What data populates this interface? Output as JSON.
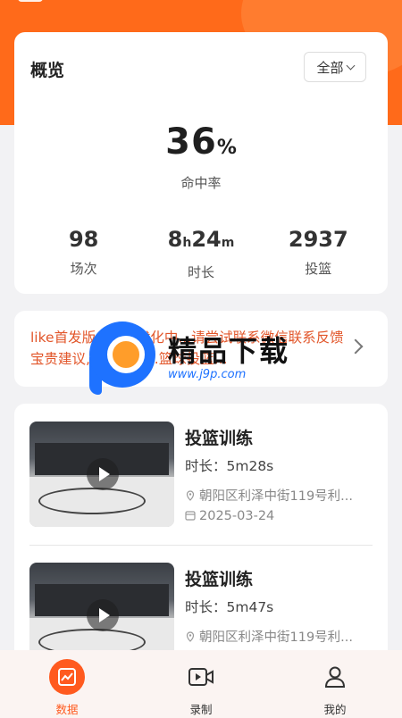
{
  "overview": {
    "title": "概览",
    "filter_label": "全部",
    "hit_rate_value": "36",
    "hit_rate_unit": "%",
    "hit_rate_label": "命中率",
    "stats": [
      {
        "value": "98",
        "label": "场次"
      },
      {
        "value_h": "8",
        "unit_h": "h",
        "value_m": "24",
        "unit_m": "m",
        "label": "时长"
      },
      {
        "value": "2937",
        "label": "投篮"
      }
    ]
  },
  "notice": {
    "text": "like首发版...持续优化中...请尝试联系微信联系反馈宝贵建议,我们打开...篮球投篮..."
  },
  "watermark": {
    "title": "精品下载",
    "url": "www.j9p.com"
  },
  "records": [
    {
      "title": "投篮训练",
      "duration": "时长：5m28s",
      "location": "朝阳区利泽中街119号利...",
      "date": "2025-03-24"
    },
    {
      "title": "投篮训练",
      "duration": "时长：5m47s",
      "location": "朝阳区利泽中街119号利..."
    }
  ],
  "tabbar": {
    "items": [
      {
        "label": "数据",
        "icon": "chart-icon",
        "active": true
      },
      {
        "label": "录制",
        "icon": "video-icon",
        "active": false
      },
      {
        "label": "我的",
        "icon": "user-icon",
        "active": false
      }
    ]
  },
  "colors": {
    "accent": "#ff5a1f",
    "notice_text": "#e2562a",
    "background": "#f2f2f4"
  }
}
